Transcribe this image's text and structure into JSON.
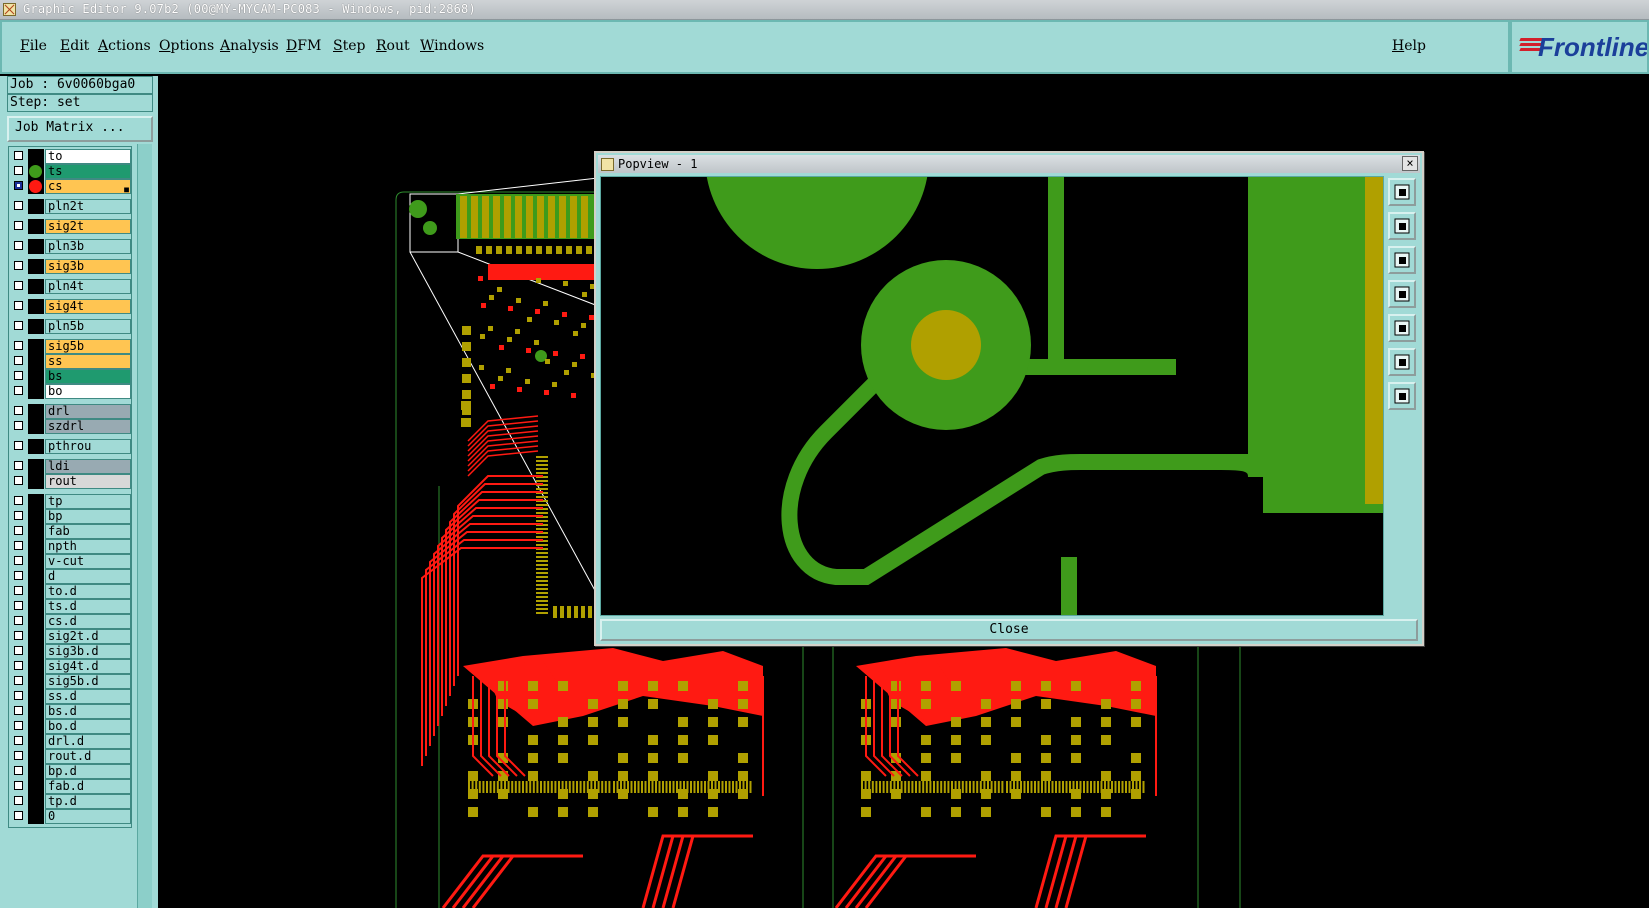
{
  "window": {
    "title": "Graphic Editor 9.07b2 (00@MY-MYCAM-PC083 - Windows, pid:2868)"
  },
  "menu": {
    "items": [
      "File",
      "Edit",
      "Actions",
      "Options",
      "Analysis",
      "DFM",
      "Step",
      "Rout",
      "Windows"
    ],
    "help": "Help"
  },
  "logo": {
    "text": "Frontline"
  },
  "side": {
    "job": "Job : 6v0060bga0",
    "step": "Step: set",
    "job_matrix": "Job Matrix ..."
  },
  "layers": [
    {
      "name": "to",
      "color": "#ffffff",
      "checked": false
    },
    {
      "name": "ts",
      "color": "#1f9a6f",
      "checked": false,
      "dot": "#3f9b1b"
    },
    {
      "name": "cs",
      "color": "#ffc552",
      "checked": true,
      "dot": "#ff1a12",
      "mark": true
    },
    {
      "name": "pln2t",
      "color": "#a1dad6",
      "checked": false
    },
    {
      "name": "sig2t",
      "color": "#ffc552",
      "checked": false
    },
    {
      "name": "pln3b",
      "color": "#a1dad6",
      "checked": false
    },
    {
      "name": "sig3b",
      "color": "#ffc552",
      "checked": false
    },
    {
      "name": "pln4t",
      "color": "#a1dad6",
      "checked": false
    },
    {
      "name": "sig4t",
      "color": "#ffc552",
      "checked": false
    },
    {
      "name": "pln5b",
      "color": "#a1dad6",
      "checked": false
    },
    {
      "name": "sig5b",
      "color": "#ffc552",
      "checked": false
    },
    {
      "name": "ss",
      "color": "#ffc552",
      "checked": false
    },
    {
      "name": "bs",
      "color": "#1f9a6f",
      "checked": false
    },
    {
      "name": "bo",
      "color": "#ffffff",
      "checked": false
    },
    {
      "name": "drl",
      "color": "#98aab2",
      "checked": false
    },
    {
      "name": "szdrl",
      "color": "#98aab2",
      "checked": false
    },
    {
      "name": "pthrou",
      "color": "#a1dad6",
      "checked": false
    },
    {
      "name": "ldi",
      "color": "#98aab2",
      "checked": false
    },
    {
      "name": "rout",
      "color": "#d8d8d8",
      "checked": false
    },
    {
      "name": "tp",
      "color": "#a1dad6",
      "checked": false
    },
    {
      "name": "bp",
      "color": "#a1dad6",
      "checked": false
    },
    {
      "name": "fab",
      "color": "#a1dad6",
      "checked": false
    },
    {
      "name": "npth",
      "color": "#a1dad6",
      "checked": false
    },
    {
      "name": "v-cut",
      "color": "#a1dad6",
      "checked": false
    },
    {
      "name": "d",
      "color": "#a1dad6",
      "checked": false
    },
    {
      "name": "to.d",
      "color": "#a1dad6",
      "checked": false
    },
    {
      "name": "ts.d",
      "color": "#a1dad6",
      "checked": false
    },
    {
      "name": "cs.d",
      "color": "#a1dad6",
      "checked": false
    },
    {
      "name": "sig2t.d",
      "color": "#a1dad6",
      "checked": false
    },
    {
      "name": "sig3b.d",
      "color": "#a1dad6",
      "checked": false
    },
    {
      "name": "sig4t.d",
      "color": "#a1dad6",
      "checked": false
    },
    {
      "name": "sig5b.d",
      "color": "#a1dad6",
      "checked": false
    },
    {
      "name": "ss.d",
      "color": "#a1dad6",
      "checked": false
    },
    {
      "name": "bs.d",
      "color": "#a1dad6",
      "checked": false
    },
    {
      "name": "bo.d",
      "color": "#a1dad6",
      "checked": false
    },
    {
      "name": "drl.d",
      "color": "#a1dad6",
      "checked": false
    },
    {
      "name": "rout.d",
      "color": "#a1dad6",
      "checked": false
    },
    {
      "name": "bp.d",
      "color": "#a1dad6",
      "checked": false
    },
    {
      "name": "fab.d",
      "color": "#a1dad6",
      "checked": false
    },
    {
      "name": "tp.d",
      "color": "#a1dad6",
      "checked": false
    },
    {
      "name": "0",
      "color": "#a1dad6",
      "checked": false
    }
  ],
  "popview": {
    "title": "Popview - 1",
    "close_label": "Close",
    "close_icon": "×",
    "tools": [
      "zoom-home-icon",
      "pan-up-icon",
      "pan-down-icon",
      "pan-left-icon",
      "pan-right-icon",
      "zoom-fit-icon",
      "zoom-out-icon"
    ]
  },
  "colors": {
    "copper_top": "#ff1a12",
    "pad": "#b0a000",
    "soldermask": "#3f9b1b",
    "board_outline": "#2e8b2e"
  }
}
